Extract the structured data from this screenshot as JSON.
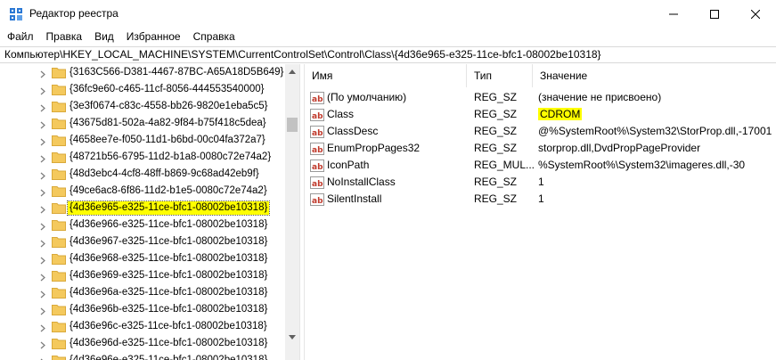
{
  "window": {
    "title": "Редактор реестра",
    "icon": "registry-editor-icon"
  },
  "menu": {
    "items": [
      "Файл",
      "Правка",
      "Вид",
      "Избранное",
      "Справка"
    ]
  },
  "address": {
    "path": "Компьютер\\HKEY_LOCAL_MACHINE\\SYSTEM\\CurrentControlSet\\Control\\Class\\{4d36e965-e325-11ce-bfc1-08002be10318}"
  },
  "tree": {
    "items": [
      {
        "label": "{3163C566-D381-4467-87BC-A65A18D5B649}",
        "selected": false
      },
      {
        "label": "{36fc9e60-c465-11cf-8056-444553540000}",
        "selected": false
      },
      {
        "label": "{3e3f0674-c83c-4558-bb26-9820e1eba5c5}",
        "selected": false
      },
      {
        "label": "{43675d81-502a-4a82-9f84-b75f418c5dea}",
        "selected": false
      },
      {
        "label": "{4658ee7e-f050-11d1-b6bd-00c04fa372a7}",
        "selected": false
      },
      {
        "label": "{48721b56-6795-11d2-b1a8-0080c72e74a2}",
        "selected": false
      },
      {
        "label": "{48d3ebc4-4cf8-48ff-b869-9c68ad42eb9f}",
        "selected": false
      },
      {
        "label": "{49ce6ac8-6f86-11d2-b1e5-0080c72e74a2}",
        "selected": false
      },
      {
        "label": "{4d36e965-e325-11ce-bfc1-08002be10318}",
        "selected": true
      },
      {
        "label": "{4d36e966-e325-11ce-bfc1-08002be10318}",
        "selected": false
      },
      {
        "label": "{4d36e967-e325-11ce-bfc1-08002be10318}",
        "selected": false
      },
      {
        "label": "{4d36e968-e325-11ce-bfc1-08002be10318}",
        "selected": false
      },
      {
        "label": "{4d36e969-e325-11ce-bfc1-08002be10318}",
        "selected": false
      },
      {
        "label": "{4d36e96a-e325-11ce-bfc1-08002be10318}",
        "selected": false
      },
      {
        "label": "{4d36e96b-e325-11ce-bfc1-08002be10318}",
        "selected": false
      },
      {
        "label": "{4d36e96c-e325-11ce-bfc1-08002be10318}",
        "selected": false
      },
      {
        "label": "{4d36e96d-e325-11ce-bfc1-08002be10318}",
        "selected": false
      },
      {
        "label": "{4d36e96e-e325-11ce-bfc1-08002be10318}",
        "selected": false
      }
    ]
  },
  "values": {
    "headers": {
      "name": "Имя",
      "type": "Тип",
      "data": "Значение"
    },
    "rows": [
      {
        "name": "(По умолчанию)",
        "type": "REG_SZ",
        "data": "(значение не присвоено)",
        "highlight": false
      },
      {
        "name": "Class",
        "type": "REG_SZ",
        "data": "CDROM",
        "highlight": true
      },
      {
        "name": "ClassDesc",
        "type": "REG_SZ",
        "data": "@%SystemRoot%\\System32\\StorProp.dll,-17001",
        "highlight": false
      },
      {
        "name": "EnumPropPages32",
        "type": "REG_SZ",
        "data": "storprop.dll,DvdPropPageProvider",
        "highlight": false
      },
      {
        "name": "IconPath",
        "type": "REG_MUL...",
        "data": "%SystemRoot%\\System32\\imageres.dll,-30",
        "highlight": false
      },
      {
        "name": "NoInstallClass",
        "type": "REG_SZ",
        "data": "1",
        "highlight": false
      },
      {
        "name": "SilentInstall",
        "type": "REG_SZ",
        "data": "1",
        "highlight": false
      }
    ]
  },
  "colors": {
    "highlight": "#ffff00",
    "folder": "#f4c95d",
    "reg_icon_red": "#c0392b"
  }
}
